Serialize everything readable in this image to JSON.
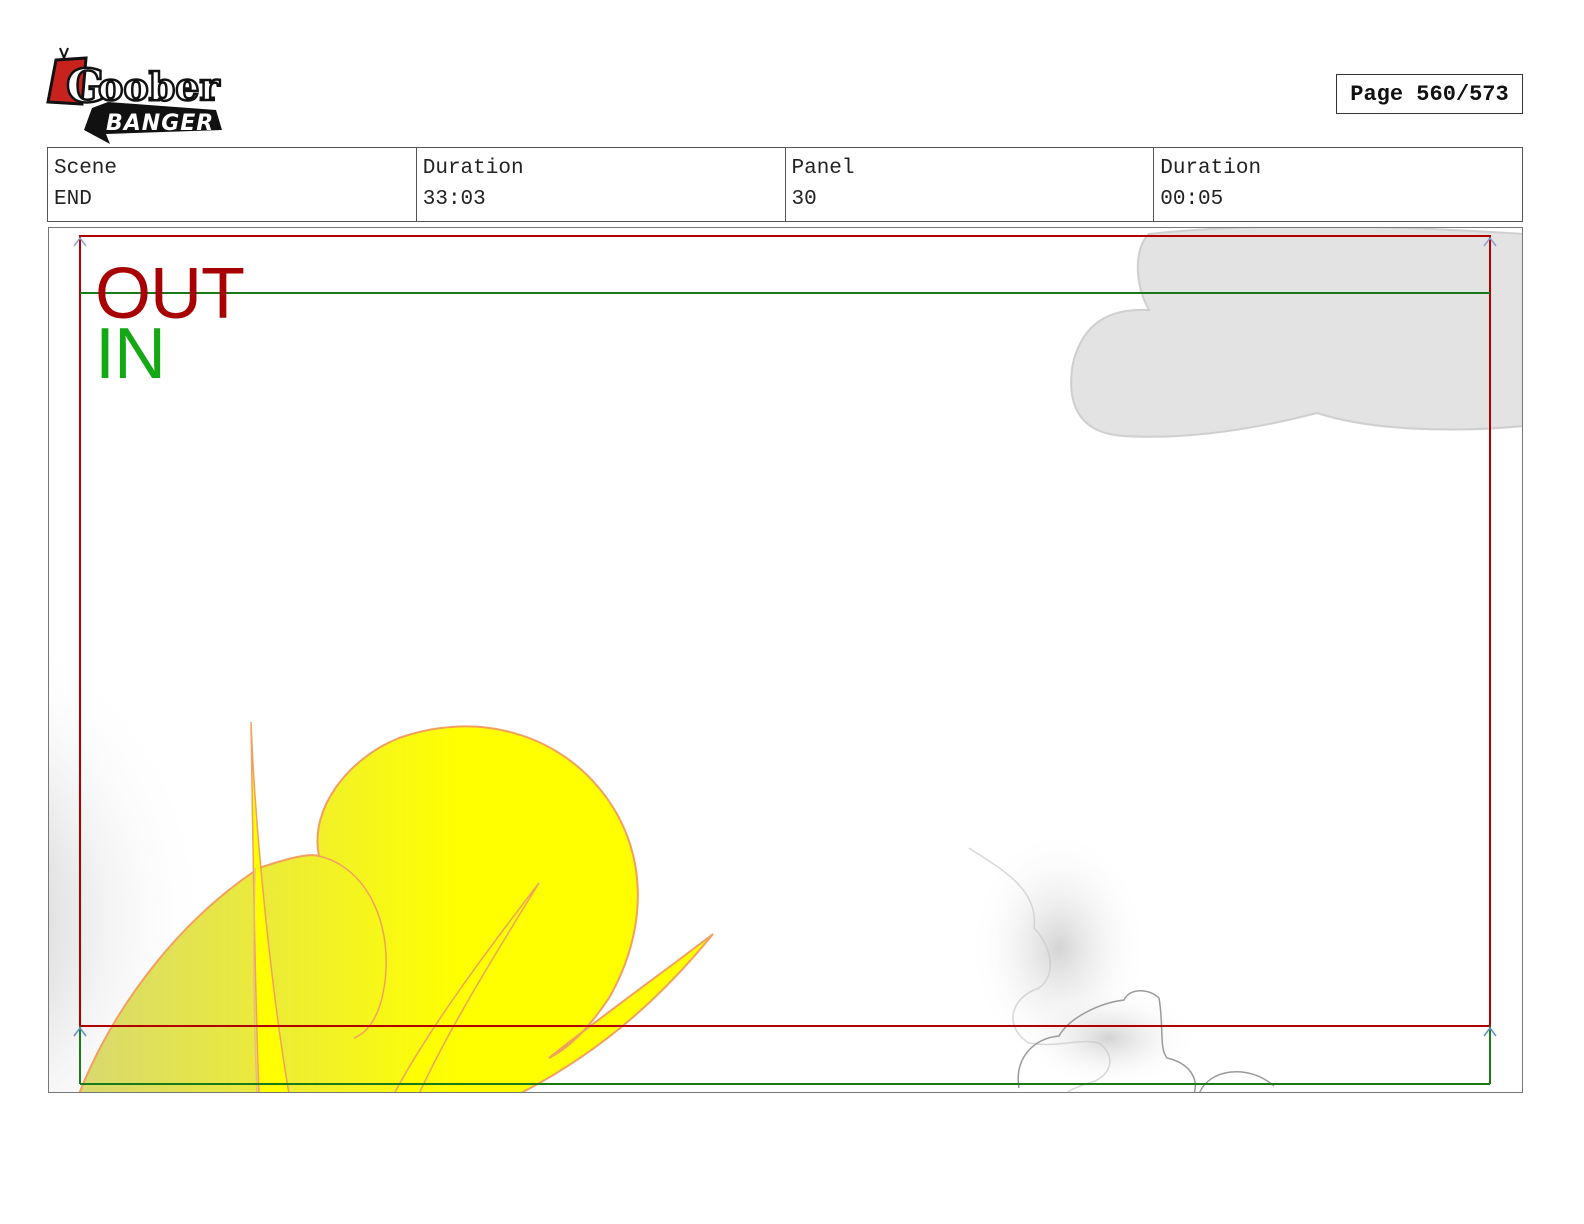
{
  "header": {
    "logo": {
      "line1": "Goober",
      "line2": "BANGER",
      "icon": "tv-logo"
    },
    "page_label": "Page 560/573"
  },
  "info": {
    "scene_label": "Scene",
    "scene_value": "END",
    "duration_label": "Duration",
    "duration_value": "33:03",
    "panel_label": "Panel",
    "panel_value": "30",
    "panel_duration_label": "Duration",
    "panel_duration_value": "00:05"
  },
  "panel": {
    "out_label": "OUT",
    "in_label": "IN",
    "colors": {
      "out_frame": "#b00000",
      "in_frame": "#1a7a1a",
      "out_text": "#a80000",
      "in_text": "#14a814",
      "sun_fill": "#ffff00",
      "sun_stroke": "#f2a060",
      "cloud": "#e3e3e3"
    }
  }
}
